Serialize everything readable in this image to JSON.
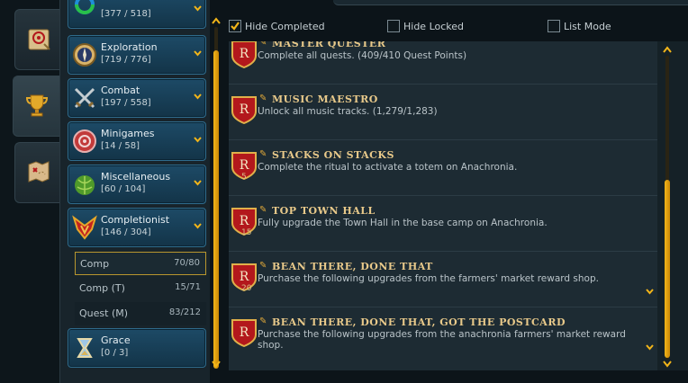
{
  "tabs": [
    {
      "icon": "scroll-icon",
      "active": false
    },
    {
      "icon": "trophy-icon",
      "active": true
    },
    {
      "icon": "map-icon",
      "active": false
    }
  ],
  "categories": [
    {
      "name": "",
      "progress": "[377 / 518]",
      "icon": "skills-ring-icon"
    },
    {
      "name": "Exploration",
      "progress": "[719 / 776]",
      "icon": "compass-icon"
    },
    {
      "name": "Combat",
      "progress": "[197 / 558]",
      "icon": "crossed-swords-icon"
    },
    {
      "name": "Minigames",
      "progress": "[14 / 58]",
      "icon": "minigames-icon"
    },
    {
      "name": "Miscellaneous",
      "progress": "[60 / 104]",
      "icon": "cabbage-icon"
    },
    {
      "name": "Completionist",
      "progress": "[146 / 304]",
      "icon": "completionist-icon"
    },
    {
      "name": "Grace",
      "progress": "[0 / 3]",
      "icon": "hourglass-icon"
    }
  ],
  "subcategories": [
    {
      "name": "Comp",
      "value": "70/80",
      "selected": true
    },
    {
      "name": "Comp (T)",
      "value": "15/71",
      "selected": false
    },
    {
      "name": "Quest (M)",
      "value": "83/212",
      "selected": false
    }
  ],
  "filters": {
    "hide_completed": {
      "label": "Hide Completed",
      "checked": true
    },
    "hide_locked": {
      "label": "Hide Locked",
      "checked": false
    },
    "list_mode": {
      "label": "List Mode",
      "checked": false
    }
  },
  "achievements": [
    {
      "title": "MASTER QUESTER",
      "desc": "Complete all quests. (409/410 Quest Points)",
      "level": "",
      "expandable": false
    },
    {
      "title": "MUSIC MAESTRO",
      "desc": "Unlock all music tracks. (1,279/1,283)",
      "level": "",
      "expandable": false
    },
    {
      "title": "STACKS ON STACKS",
      "desc": "Complete the ritual to activate a totem on Anachronia.",
      "level": "5",
      "expandable": false
    },
    {
      "title": "TOP TOWN HALL",
      "desc": "Fully upgrade the Town Hall in the base camp on Anachronia.",
      "level": "15",
      "expandable": false
    },
    {
      "title": "BEAN THERE, DONE THAT",
      "desc": "Purchase the following upgrades from the farmers' market reward shop.",
      "level": "20",
      "expandable": true
    },
    {
      "title": "BEAN THERE, DONE THAT, GOT THE POSTCARD",
      "desc": "Purchase the following upgrades from the anachronia farmers' market reward shop.",
      "level": "",
      "expandable": true
    }
  ],
  "colors": {
    "accent_gold": "#f2b519",
    "title_gold": "#e8c98a",
    "category_blue": "#1d4a66",
    "badge_red": "#b3181c"
  }
}
